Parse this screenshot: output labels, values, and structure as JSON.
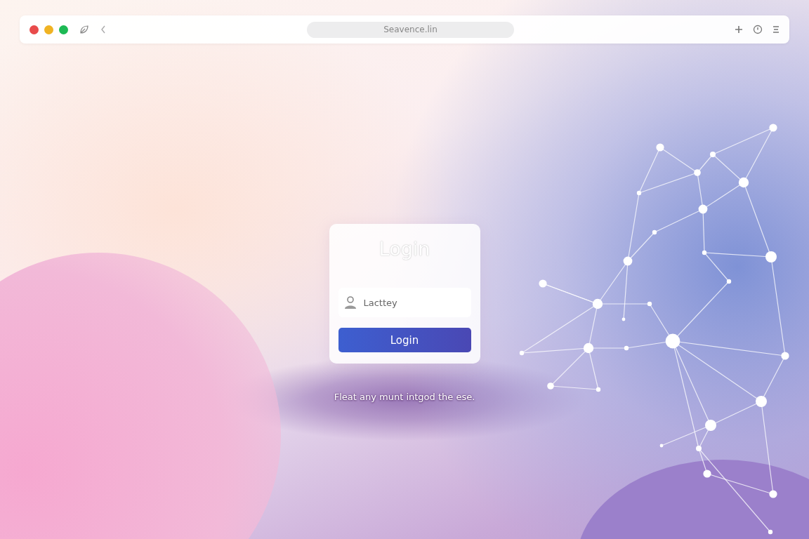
{
  "browser": {
    "address": "Seavence.lin"
  },
  "login_card": {
    "title": "Login",
    "username_field": {
      "placeholder": "Lacttey"
    },
    "submit_button": "Login"
  },
  "footer_text": "Fleat any munt intgod the ese."
}
